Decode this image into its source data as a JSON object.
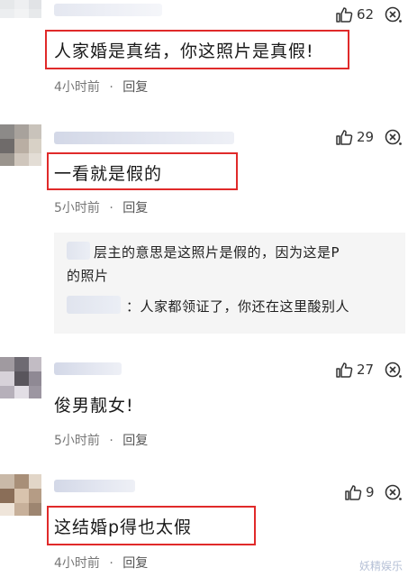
{
  "colors": {
    "highlight_box": "#e02a2a",
    "meta_text": "#777777",
    "reply_panel_bg": "#f5f5f5"
  },
  "comments": [
    {
      "like_count": "62",
      "text": "人家婚是真结，你这照片是真假!",
      "time": "4小时前",
      "reply_label": "回复"
    },
    {
      "like_count": "29",
      "text": "一看就是假的",
      "time": "5小时前",
      "reply_label": "回复"
    },
    {
      "like_count": "27",
      "text": "俊男靓女!",
      "time": "5小时前",
      "reply_label": "回复"
    },
    {
      "like_count": "9",
      "text": "这结婚p得也太假",
      "time": "4小时前",
      "reply_label": "回复"
    }
  ],
  "replies": [
    {
      "text_line1": "层主的意思是这照片是假的，因为这是P",
      "text_line2": "的照片"
    },
    {
      "text": "：人家都领证了，你还在这里酸别人"
    }
  ],
  "separator": "·",
  "icons": {
    "like": "thumbs-up-icon",
    "more": "close-circle-icon"
  },
  "watermark": "妖精娱乐"
}
